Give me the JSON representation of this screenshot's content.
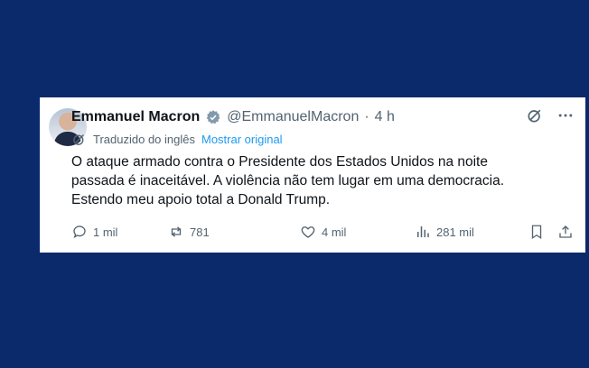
{
  "author": {
    "name": "Emmanuel Macron",
    "handle": "@EmmanuelMacron",
    "separator": "·",
    "time": "4 h"
  },
  "translation": {
    "note": "Traduzido do inglês",
    "show_original": "Mostrar original"
  },
  "tweet": {
    "lines": [
      "O ataque armado contra o Presidente dos Estados Unidos na noite",
      "passada é inaceitável. A violência não tem lugar em uma democracia.",
      "Estendo meu apoio total a Donald Trump."
    ]
  },
  "actions": {
    "replies": "1 mil",
    "reposts": "781",
    "likes": "4 mil",
    "views": "281 mil"
  },
  "colors": {
    "background": "#0b2a6b",
    "card": "#ffffff",
    "text": "#0f1419",
    "muted": "#536471",
    "link": "#1d9bf0"
  }
}
